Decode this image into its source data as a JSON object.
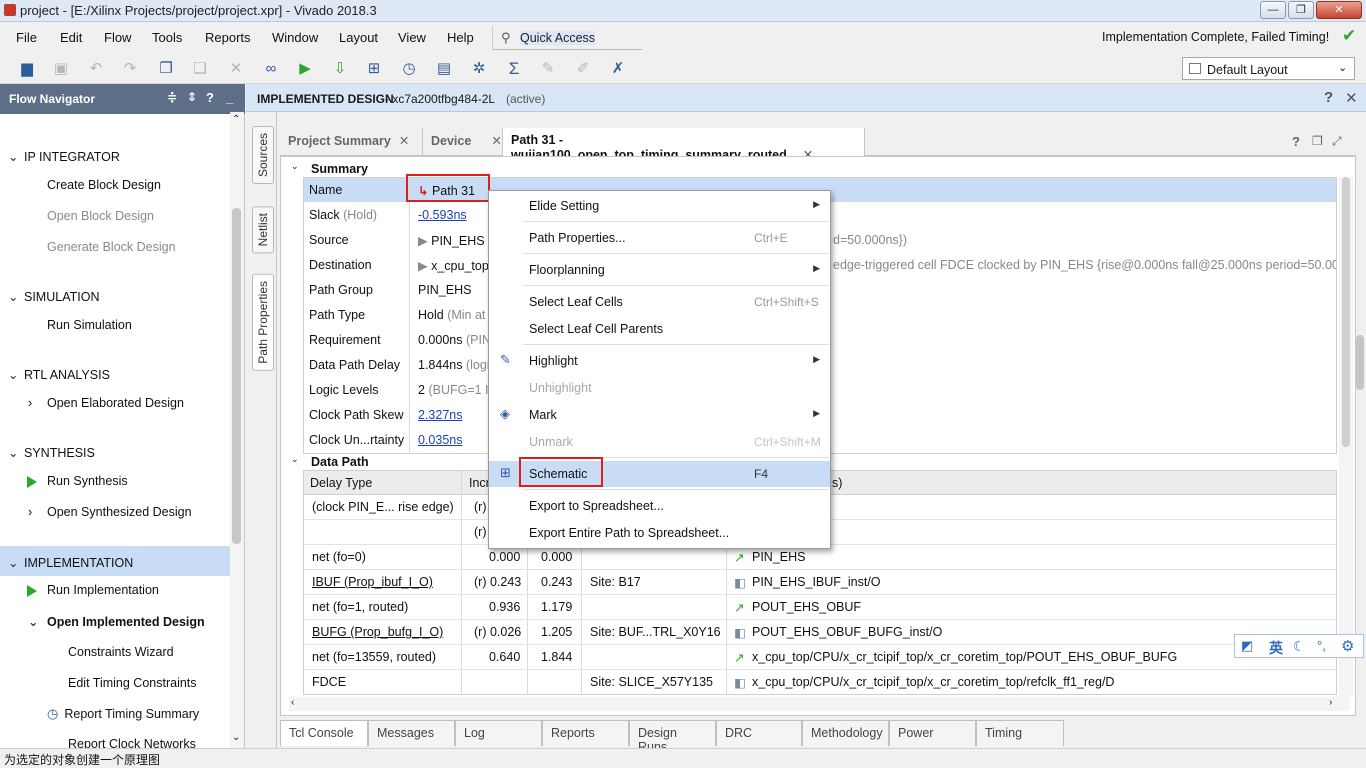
{
  "window": {
    "title": "project - [E:/Xilinx Projects/project/project.xpr] - Vivado 2018.3"
  },
  "menu": [
    "File",
    "Edit",
    "Flow",
    "Tools",
    "Reports",
    "Window",
    "Layout",
    "View",
    "Help"
  ],
  "quick_access": "Quick Access",
  "status_message": "Implementation Complete, Failed Timing!",
  "layout_select": "Default Layout",
  "flow_nav": {
    "title": "Flow Navigator",
    "sections": [
      {
        "label": "IP INTEGRATOR",
        "items": [
          "Create Block Design",
          "Open Block Design",
          "Generate Block Design"
        ]
      },
      {
        "label": "SIMULATION",
        "items": [
          "Run Simulation"
        ]
      },
      {
        "label": "RTL ANALYSIS",
        "items": [
          "Open Elaborated Design"
        ]
      },
      {
        "label": "SYNTHESIS",
        "items": [
          "Run Synthesis",
          "Open Synthesized Design"
        ]
      },
      {
        "label": "IMPLEMENTATION",
        "items": [
          "Run Implementation",
          "Open Implemented Design",
          "Constraints Wizard",
          "Edit Timing Constraints",
          "Report Timing Summary",
          "Report Clock Networks"
        ]
      }
    ]
  },
  "side_tabs": [
    "Sources",
    "Netlist",
    "Path Properties"
  ],
  "design_header": {
    "title": "IMPLEMENTED DESIGN",
    "part": " - xc7a200tfbg484-2L",
    "state": "(active)"
  },
  "tabs": [
    "Project Summary",
    "Device",
    "Path 31 - wujian100_open_top_timing_summary_routed"
  ],
  "summary": {
    "title": "Summary",
    "rows": [
      {
        "label": "Name",
        "value": "Path 31",
        "extra": ""
      },
      {
        "label": "Slack",
        "label_note": "(Hold)",
        "value": "-0.593ns",
        "extra": ""
      },
      {
        "label": "Source",
        "value": "PIN_EHS",
        "extra": "d=50.000ns})"
      },
      {
        "label": "Destination",
        "value": "x_cpu_top",
        "extra": "edge-triggered cell FDCE clocked by PIN_EHS  {rise@0.000ns fall@25.000ns period=50.000"
      },
      {
        "label": "Path Group",
        "value": "PIN_EHS",
        "extra": ""
      },
      {
        "label": "Path Type",
        "value": "Hold",
        "value_note": "(Min at F",
        "extra": ""
      },
      {
        "label": "Requirement",
        "value": "0.000ns",
        "value_note": "(PIN",
        "extra": ""
      },
      {
        "label": "Data Path Delay",
        "value": "1.844ns",
        "value_note": "(logi",
        "extra": ""
      },
      {
        "label": "Logic Levels",
        "value": "2",
        "value_note": "(BUFG=1 I",
        "extra": ""
      },
      {
        "label": "Clock Path Skew",
        "value": "2.327ns",
        "extra": ""
      },
      {
        "label": "Clock Un...rtainty",
        "value": "0.035ns",
        "extra": ""
      }
    ]
  },
  "data_path": {
    "title": "Data Path",
    "headers": [
      "Delay Type",
      "Incr",
      "",
      "",
      "s)"
    ],
    "rows": [
      [
        "(clock PIN_E... rise edge)",
        "(r)",
        "",
        "",
        ""
      ],
      [
        "",
        "(r)",
        "",
        "",
        ""
      ],
      [
        "net (fo=0)",
        "0.000",
        "0.000",
        "",
        "PIN_EHS"
      ],
      [
        "IBUF (Prop_ibuf_I_O)",
        "(r) 0.243",
        "0.243",
        "Site: B17",
        "PIN_EHS_IBUF_inst/O"
      ],
      [
        "net (fo=1, routed)",
        "0.936",
        "1.179",
        "",
        "POUT_EHS_OBUF"
      ],
      [
        "BUFG (Prop_bufg_I_O)",
        "(r) 0.026",
        "1.205",
        "Site: BUF...TRL_X0Y16",
        "POUT_EHS_OBUF_BUFG_inst/O"
      ],
      [
        "net (fo=13559, routed)",
        "0.640",
        "1.844",
        "",
        "x_cpu_top/CPU/x_cr_tcipif_top/x_cr_coretim_top/POUT_EHS_OBUF_BUFG"
      ],
      [
        "FDCE",
        "",
        "",
        "Site: SLICE_X57Y135",
        "x_cpu_top/CPU/x_cr_tcipif_top/x_cr_coretim_top/refclk_ff1_reg/D"
      ]
    ]
  },
  "context_menu": [
    {
      "label": "Elide Setting",
      "shortcut": "",
      "submenu": true,
      "enabled": true
    },
    {
      "label": "Path Properties...",
      "shortcut": "Ctrl+E",
      "submenu": false,
      "enabled": true
    },
    {
      "label": "Floorplanning",
      "shortcut": "",
      "submenu": true,
      "enabled": true
    },
    {
      "label": "Select Leaf Cells",
      "shortcut": "Ctrl+Shift+S",
      "submenu": false,
      "enabled": true
    },
    {
      "label": "Select Leaf Cell Parents",
      "shortcut": "",
      "submenu": false,
      "enabled": true
    },
    {
      "label": "Highlight",
      "shortcut": "",
      "submenu": true,
      "enabled": true
    },
    {
      "label": "Unhighlight",
      "shortcut": "",
      "submenu": false,
      "enabled": false
    },
    {
      "label": "Mark",
      "shortcut": "",
      "submenu": true,
      "enabled": true
    },
    {
      "label": "Unmark",
      "shortcut": "Ctrl+Shift+M",
      "submenu": false,
      "enabled": false
    },
    {
      "label": "Schematic",
      "shortcut": "F4",
      "submenu": false,
      "enabled": true
    },
    {
      "label": "Export to Spreadsheet...",
      "shortcut": "",
      "submenu": false,
      "enabled": true
    },
    {
      "label": "Export Entire Path to Spreadsheet...",
      "shortcut": "",
      "submenu": false,
      "enabled": true
    }
  ],
  "bottom_tabs": [
    "Tcl Console",
    "Messages",
    "Log",
    "Reports",
    "Design Runs",
    "DRC",
    "Methodology",
    "Power",
    "Timing"
  ],
  "status_bar": "为选定的对象创建一个原理图",
  "ime": {
    "lang": "英"
  },
  "colors": {
    "accent": "#2d5d9c",
    "nav_header": "#5d6f86",
    "selection": "#c9dcf5",
    "highlight_box": "#e01d1d"
  }
}
